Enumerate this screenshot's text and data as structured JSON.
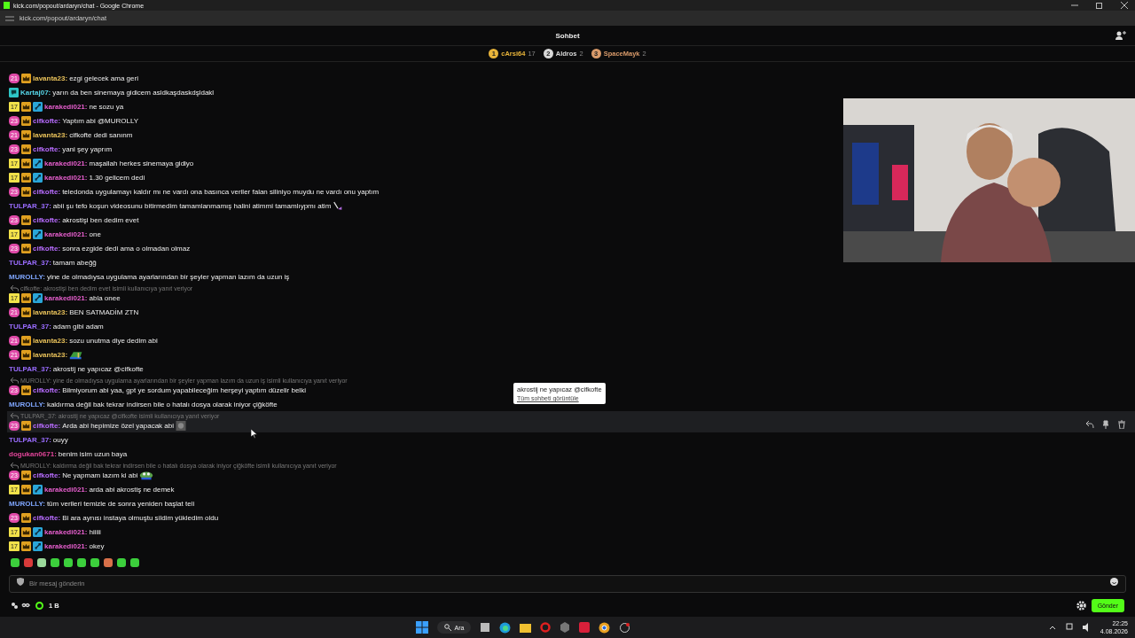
{
  "browser": {
    "title": "kick.com/popout/ardaryn/chat - Google Chrome",
    "url": "kick.com/popout/ardaryn/chat"
  },
  "header": {
    "title": "Sohbet"
  },
  "leaderboard": [
    {
      "rank": "1",
      "name": "cArsi64",
      "count": "17",
      "color": "#e8b43a"
    },
    {
      "rank": "2",
      "name": "Aldros",
      "count": "2",
      "color": "#d8d8d8"
    },
    {
      "rank": "3",
      "name": "SpaceMayk",
      "count": "2",
      "color": "#d89a6a"
    }
  ],
  "messages": [
    {
      "badges": [
        {
          "kind": "sub",
          "label": "21"
        },
        {
          "kind": "crown"
        }
      ],
      "user": "lavanta23:",
      "color": "#e8c15a",
      "text": "ezgi gelecek ama geri",
      "highlighted": false
    },
    {
      "badges": [
        {
          "kind": "kick"
        }
      ],
      "user": "Kartaj07:",
      "color": "#56d6e8",
      "text": "yarın da ben sinemaya gidicem asldkaşdaskdşldakl",
      "highlighted": false
    },
    {
      "badges": [
        {
          "kind": "gift",
          "label": "17"
        },
        {
          "kind": "crown"
        },
        {
          "kind": "mod"
        }
      ],
      "user": "karakedi021:",
      "color": "#e85fcf",
      "text": "ne sozu ya",
      "highlighted": false
    },
    {
      "badges": [
        {
          "kind": "sub",
          "label": "23"
        },
        {
          "kind": "crown"
        }
      ],
      "user": "cifkofte:",
      "color": "#b86cff",
      "text": "Yaptım abi @MUROLLY",
      "highlighted": false
    },
    {
      "badges": [
        {
          "kind": "sub",
          "label": "21"
        },
        {
          "kind": "crown"
        }
      ],
      "user": "lavanta23:",
      "color": "#e8c15a",
      "text": "cifkofte dedi sanınm",
      "highlighted": false
    },
    {
      "badges": [
        {
          "kind": "sub",
          "label": "23"
        },
        {
          "kind": "crown"
        }
      ],
      "user": "cifkofte:",
      "color": "#b86cff",
      "text": "yani şey yaprım",
      "highlighted": false
    },
    {
      "badges": [
        {
          "kind": "gift",
          "label": "17"
        },
        {
          "kind": "crown"
        },
        {
          "kind": "mod"
        }
      ],
      "user": "karakedi021:",
      "color": "#e85fcf",
      "text": "maşallah herkes sinemaya gidiyo",
      "highlighted": false
    },
    {
      "badges": [
        {
          "kind": "gift",
          "label": "17"
        },
        {
          "kind": "crown"
        },
        {
          "kind": "mod"
        }
      ],
      "user": "karakedi021:",
      "color": "#e85fcf",
      "text": "1.30 gelicem dedi",
      "highlighted": false
    },
    {
      "badges": [
        {
          "kind": "sub",
          "label": "23"
        },
        {
          "kind": "crown"
        }
      ],
      "user": "cifkofte:",
      "color": "#b86cff",
      "text": "teledonda uygulamayı kaldır mı ne vardı ona basınca veriler falan siliniyo muydu ne vardı onu yaptım",
      "highlighted": false
    },
    {
      "user": "TULPAR_37:",
      "color": "#9a6cff",
      "text": "abii şu tefo koşun videosunu bitirmedim tamamlanmamış halini atimmi tamamlıypmı atim",
      "emote": {
        "kind": "bolt"
      },
      "highlighted": false
    },
    {
      "badges": [
        {
          "kind": "sub",
          "label": "23"
        },
        {
          "kind": "crown"
        }
      ],
      "user": "cifkofte:",
      "color": "#b86cff",
      "text": "akrostişi ben dedim evet",
      "highlighted": false
    },
    {
      "badges": [
        {
          "kind": "gift",
          "label": "17"
        },
        {
          "kind": "crown"
        },
        {
          "kind": "mod"
        }
      ],
      "user": "karakedi021:",
      "color": "#e85fcf",
      "text": "one",
      "highlighted": false
    },
    {
      "badges": [
        {
          "kind": "sub",
          "label": "23"
        },
        {
          "kind": "crown"
        }
      ],
      "user": "cifkofte:",
      "color": "#b86cff",
      "text": "sonra ezgide dedi ama o olmadan olmaz",
      "highlighted": false
    },
    {
      "user": "TULPAR_37:",
      "color": "#9a6cff",
      "text": "tamam abeğğ",
      "highlighted": false
    },
    {
      "user": "MUROLLY:",
      "color": "#7fa6ff",
      "text": "yine de olmadıysa uygulama ayarlarından bir şeyler yapman lazım da uzun iş",
      "highlighted": false
    },
    {
      "reply": "cifkofte: akrostişi ben dedim evet isimli kullanıcıya yanıt veriyor",
      "badges": [
        {
          "kind": "gift",
          "label": "17"
        },
        {
          "kind": "crown"
        },
        {
          "kind": "mod"
        }
      ],
      "user": "karakedi021:",
      "color": "#e85fcf",
      "text": "abla onee",
      "highlighted": false
    },
    {
      "badges": [
        {
          "kind": "sub",
          "label": "21"
        },
        {
          "kind": "crown"
        }
      ],
      "user": "lavanta23:",
      "color": "#e8c15a",
      "text": "BEN SATMADİM ZTN",
      "highlighted": false
    },
    {
      "user": "TULPAR_37:",
      "color": "#9a6cff",
      "text": "adam gibi adam",
      "highlighted": false
    },
    {
      "badges": [
        {
          "kind": "sub",
          "label": "21"
        },
        {
          "kind": "crown"
        }
      ],
      "user": "lavanta23:",
      "color": "#e8c15a",
      "text": "sozu unutma diye dedim abi",
      "highlighted": false
    },
    {
      "badges": [
        {
          "kind": "sub",
          "label": "21"
        },
        {
          "kind": "crown"
        }
      ],
      "user": "lavanta23:",
      "color": "#e8c15a",
      "emote": {
        "kind": "flag"
      },
      "highlighted": false
    },
    {
      "user": "TULPAR_37:",
      "color": "#9a6cff",
      "text": "akrostij ne yapıcaz @cifkofte",
      "highlighted": false
    },
    {
      "reply": "MUROLLY: yine de olmadıysa uygulama ayarlarından bir şeyler yapman lazım da uzun iş isimli kullanıcıya yanıt veriyor",
      "badges": [
        {
          "kind": "sub",
          "label": "23"
        },
        {
          "kind": "crown"
        }
      ],
      "user": "cifkofte:",
      "color": "#b86cff",
      "text": "Bilmiyorum abi yaa, gpt ye sordum yapabileceğim herşeyi yaptım düzelir belki",
      "highlighted": false
    },
    {
      "user": "MUROLLY:",
      "color": "#7fa6ff",
      "text": "kaldırma değil bak tekrar indirsen bile o hatalı dosya olarak iniyor çiğköfte",
      "highlighted": false
    },
    {
      "reply": "TULPAR_37: akrostij ne yapıcaz @cifkofte isimli kullanıcıya yanıt veriyor",
      "badges": [
        {
          "kind": "sub",
          "label": "23"
        },
        {
          "kind": "crown"
        }
      ],
      "user": "cifkofte:",
      "color": "#b86cff",
      "text": "Arda abi hepimize özel yapacak abi",
      "emote": {
        "kind": "grey"
      },
      "highlighted": true
    },
    {
      "user": "TULPAR_37:",
      "color": "#9a6cff",
      "text": "ouyy",
      "highlighted": false
    },
    {
      "user": "dogukan0671:",
      "color": "#e2459a",
      "text": "benim isim uzun baya",
      "highlighted": false
    },
    {
      "reply": "MUROLLY: kaldırma değil bak tekrar indirsen bile o hatalı dosya olarak iniyor çiğköfte isimli kullanıcıya yanıt veriyor",
      "badges": [
        {
          "kind": "sub",
          "label": "23"
        },
        {
          "kind": "crown"
        }
      ],
      "user": "cifkofte:",
      "color": "#b86cff",
      "text": "Ne yapmam lazım ki abi",
      "emote": {
        "kind": "frog"
      },
      "highlighted": false
    },
    {
      "badges": [
        {
          "kind": "gift",
          "label": "17"
        },
        {
          "kind": "crown"
        },
        {
          "kind": "mod"
        }
      ],
      "user": "karakedi021:",
      "color": "#e85fcf",
      "text": "arda abi akrostiş ne demek",
      "highlighted": false
    },
    {
      "user": "MUROLLY:",
      "color": "#7fa6ff",
      "text": "tüm verileri temizle de sonra yeniden başlat teli",
      "highlighted": false
    },
    {
      "badges": [
        {
          "kind": "sub",
          "label": "23"
        },
        {
          "kind": "crown"
        }
      ],
      "user": "cifkofte:",
      "color": "#b86cff",
      "text": "Bi ara aynısı instaya olmuştu sildim yükledim oldu",
      "highlighted": false
    },
    {
      "badges": [
        {
          "kind": "gift",
          "label": "17"
        },
        {
          "kind": "crown"
        },
        {
          "kind": "mod"
        }
      ],
      "user": "karakedi021:",
      "color": "#e85fcf",
      "text": "hiiiii",
      "highlighted": false
    },
    {
      "badges": [
        {
          "kind": "gift",
          "label": "17"
        },
        {
          "kind": "crown"
        },
        {
          "kind": "mod"
        }
      ],
      "user": "karakedi021:",
      "color": "#e85fcf",
      "text": "okey",
      "highlighted": false
    }
  ],
  "tooltip": {
    "text": "akrostij ne yapıcaz @cifkofte",
    "link": "Tüm sohbeti görüntüle"
  },
  "emote_bar": [
    {
      "color": "#3ccf3c"
    },
    {
      "color": "#d83a3a"
    },
    {
      "color": "#9ad89a"
    },
    {
      "color": "#3ccf3c"
    },
    {
      "color": "#3ccf3c"
    },
    {
      "color": "#3ccf3c"
    },
    {
      "color": "#3ccf3c"
    },
    {
      "color": "#d8704a"
    },
    {
      "color": "#3ccf3c"
    },
    {
      "color": "#3ccf3c"
    }
  ],
  "input": {
    "placeholder": "Bir mesaj gönderin"
  },
  "footer": {
    "viewers": "1 B",
    "send": "Gönder"
  },
  "taskbar": {
    "search": "Ara",
    "time": "22:25",
    "date": "4.08.2026"
  }
}
